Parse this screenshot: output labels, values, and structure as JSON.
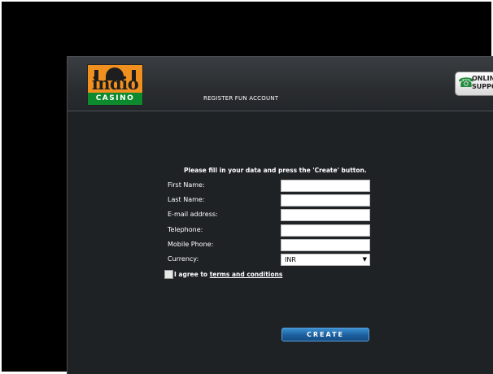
{
  "header": {
    "logo_word": "indio",
    "logo_sub": "CASINO",
    "title": "REGISTER FUN ACCOUNT",
    "support_line1": "ONLINE",
    "support_line2": "SUPPORT"
  },
  "form": {
    "intro": "Please fill in your data and press the 'Create' button.",
    "fields": [
      {
        "label": "First Name:",
        "value": ""
      },
      {
        "label": "Last Name:",
        "value": ""
      },
      {
        "label": "E-mail address:",
        "value": ""
      },
      {
        "label": "Telephone:",
        "value": ""
      },
      {
        "label": "Mobile Phone:",
        "value": ""
      }
    ],
    "currency_label": "Currency:",
    "currency_value": "INR",
    "agree_prefix": "I agree to",
    "agree_link": "terms and conditions",
    "create_label": "CREATE"
  },
  "colors": {
    "accent": "#1c5f9e",
    "logo_orange": "#f0901e",
    "logo_green": "#0d8a2e"
  }
}
